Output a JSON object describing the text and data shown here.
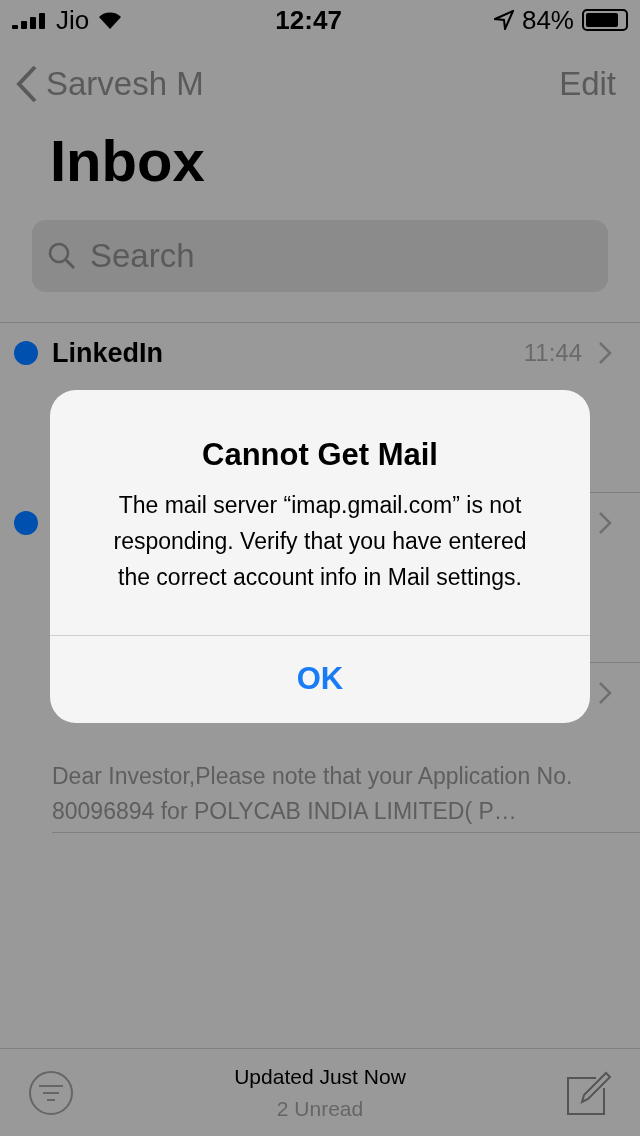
{
  "status_bar": {
    "carrier": "Jio",
    "time": "12:47",
    "battery": "84%"
  },
  "nav": {
    "back": "Sarvesh M",
    "edit": "Edit"
  },
  "title": "Inbox",
  "search": {
    "placeholder": "Search"
  },
  "messages": [
    {
      "sender": "LinkedIn",
      "time": "11:44",
      "unread": true
    },
    {
      "unread": true
    },
    {
      "unread": false,
      "preview": "Dear Investor,Please note that your Application No. 80096894 for POLYCAB INDIA LIMITED( P…"
    }
  ],
  "toolbar": {
    "status": "Updated Just Now",
    "unread": "2 Unread"
  },
  "alert": {
    "title": "Cannot Get Mail",
    "message": "The mail server “imap.gmail.com” is not responding. Verify that you have entered the correct account info in Mail settings.",
    "buttons": [
      "OK"
    ]
  }
}
